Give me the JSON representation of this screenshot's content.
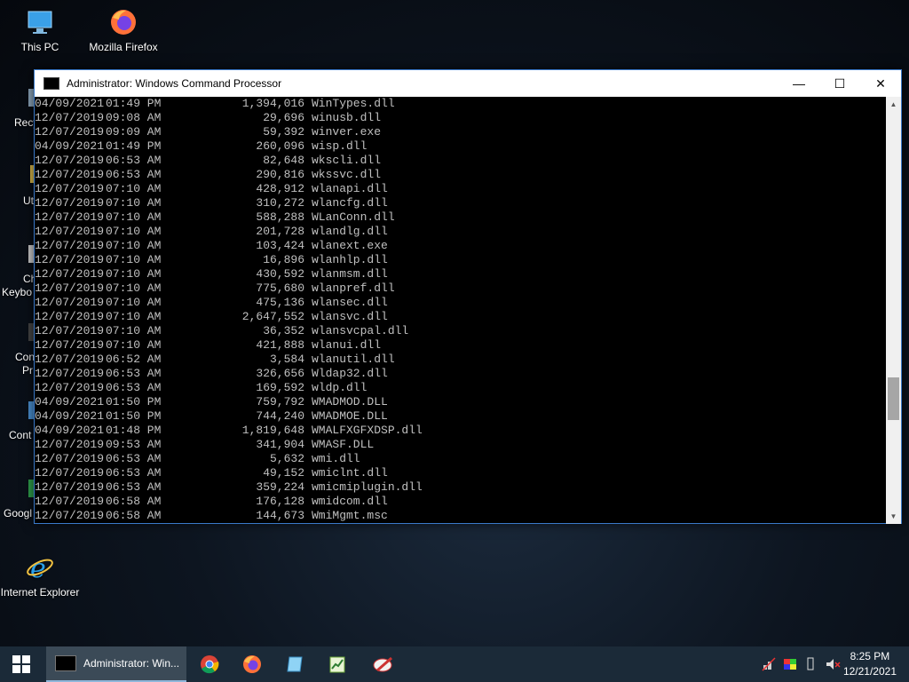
{
  "desktop": {
    "icons": [
      {
        "label": "This PC"
      },
      {
        "label": "Mozilla Firefox"
      },
      {
        "label": "Internet Explorer"
      }
    ],
    "partial_labels": [
      "Recy",
      "Ut",
      "Ch",
      "Keybo",
      "Con",
      "Pr",
      "Cont",
      "Googl"
    ]
  },
  "window": {
    "title": "Administrator: Windows Command Processor",
    "minimize": "—",
    "maximize": "☐",
    "close": "✕"
  },
  "console": {
    "rows": [
      {
        "date": "04/09/2021",
        "time": "01:49 PM",
        "size": "1,394,016",
        "name": "WinTypes.dll"
      },
      {
        "date": "12/07/2019",
        "time": "09:08 AM",
        "size": "29,696",
        "name": "winusb.dll"
      },
      {
        "date": "12/07/2019",
        "time": "09:09 AM",
        "size": "59,392",
        "name": "winver.exe"
      },
      {
        "date": "04/09/2021",
        "time": "01:49 PM",
        "size": "260,096",
        "name": "wisp.dll"
      },
      {
        "date": "12/07/2019",
        "time": "06:53 AM",
        "size": "82,648",
        "name": "wkscli.dll"
      },
      {
        "date": "12/07/2019",
        "time": "06:53 AM",
        "size": "290,816",
        "name": "wkssvc.dll"
      },
      {
        "date": "12/07/2019",
        "time": "07:10 AM",
        "size": "428,912",
        "name": "wlanapi.dll"
      },
      {
        "date": "12/07/2019",
        "time": "07:10 AM",
        "size": "310,272",
        "name": "wlancfg.dll"
      },
      {
        "date": "12/07/2019",
        "time": "07:10 AM",
        "size": "588,288",
        "name": "WLanConn.dll"
      },
      {
        "date": "12/07/2019",
        "time": "07:10 AM",
        "size": "201,728",
        "name": "wlandlg.dll"
      },
      {
        "date": "12/07/2019",
        "time": "07:10 AM",
        "size": "103,424",
        "name": "wlanext.exe"
      },
      {
        "date": "12/07/2019",
        "time": "07:10 AM",
        "size": "16,896",
        "name": "wlanhlp.dll"
      },
      {
        "date": "12/07/2019",
        "time": "07:10 AM",
        "size": "430,592",
        "name": "wlanmsm.dll"
      },
      {
        "date": "12/07/2019",
        "time": "07:10 AM",
        "size": "775,680",
        "name": "wlanpref.dll"
      },
      {
        "date": "12/07/2019",
        "time": "07:10 AM",
        "size": "475,136",
        "name": "wlansec.dll"
      },
      {
        "date": "12/07/2019",
        "time": "07:10 AM",
        "size": "2,647,552",
        "name": "wlansvc.dll"
      },
      {
        "date": "12/07/2019",
        "time": "07:10 AM",
        "size": "36,352",
        "name": "wlansvcpal.dll"
      },
      {
        "date": "12/07/2019",
        "time": "07:10 AM",
        "size": "421,888",
        "name": "wlanui.dll"
      },
      {
        "date": "12/07/2019",
        "time": "06:52 AM",
        "size": "3,584",
        "name": "wlanutil.dll"
      },
      {
        "date": "12/07/2019",
        "time": "06:53 AM",
        "size": "326,656",
        "name": "Wldap32.dll"
      },
      {
        "date": "12/07/2019",
        "time": "06:53 AM",
        "size": "169,592",
        "name": "wldp.dll"
      },
      {
        "date": "04/09/2021",
        "time": "01:50 PM",
        "size": "759,792",
        "name": "WMADMOD.DLL"
      },
      {
        "date": "04/09/2021",
        "time": "01:50 PM",
        "size": "744,240",
        "name": "WMADMOE.DLL"
      },
      {
        "date": "04/09/2021",
        "time": "01:48 PM",
        "size": "1,819,648",
        "name": "WMALFXGFXDSP.dll"
      },
      {
        "date": "12/07/2019",
        "time": "09:53 AM",
        "size": "341,904",
        "name": "WMASF.DLL"
      },
      {
        "date": "12/07/2019",
        "time": "06:53 AM",
        "size": "5,632",
        "name": "wmi.dll"
      },
      {
        "date": "12/07/2019",
        "time": "06:53 AM",
        "size": "49,152",
        "name": "wmiclnt.dll"
      },
      {
        "date": "12/07/2019",
        "time": "06:53 AM",
        "size": "359,224",
        "name": "wmicmiplugin.dll"
      },
      {
        "date": "12/07/2019",
        "time": "06:58 AM",
        "size": "176,128",
        "name": "wmidcom.dll"
      },
      {
        "date": "12/07/2019",
        "time": "06:58 AM",
        "size": "144,673",
        "name": "WmiMgmt.msc"
      }
    ],
    "scroll_position": 0.75
  },
  "taskbar": {
    "active_task_label": "Administrator: Win...",
    "pinned": [
      "chrome-icon",
      "firefox-icon",
      "notepad-icon",
      "spreadsheet-icon",
      "paint-icon"
    ],
    "clock": {
      "time": "8:25 PM",
      "date": "12/21/2021"
    }
  }
}
